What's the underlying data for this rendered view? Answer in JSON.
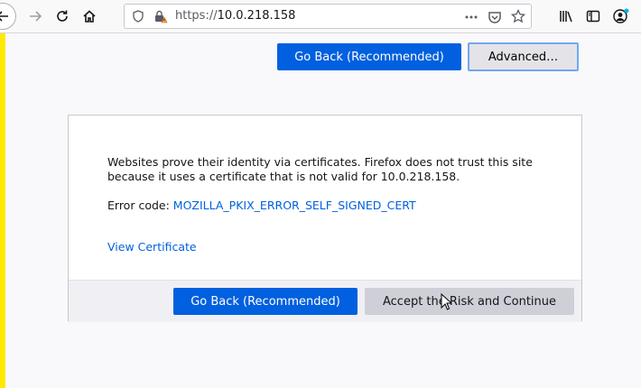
{
  "browser": {
    "url_scheme": "https://",
    "url_host": "10.0.218.158",
    "icons": [
      "back-arrow-icon",
      "forward-arrow-icon",
      "reload-icon",
      "home-icon",
      "shield-icon",
      "warning-lock-icon",
      "more-dots-icon",
      "pocket-icon",
      "star-icon",
      "library-icon",
      "sidebar-icon",
      "account-icon"
    ]
  },
  "page": {
    "top_go_back": "Go Back (Recommended)",
    "top_advanced": "Advanced…",
    "message": "Websites prove their identity via certificates. Firefox does not trust this site because it uses a certificate that is not valid for 10.0.218.158.",
    "error_code_label": "Error code:",
    "error_code": "MOZILLA_PKIX_ERROR_SELF_SIGNED_CERT",
    "view_certificate": "View Certificate",
    "go_back": "Go Back (Recommended)",
    "accept": "Accept the Risk and Continue"
  },
  "colors": {
    "accent": "#0060df",
    "warning_stripe": "#ffe900"
  }
}
